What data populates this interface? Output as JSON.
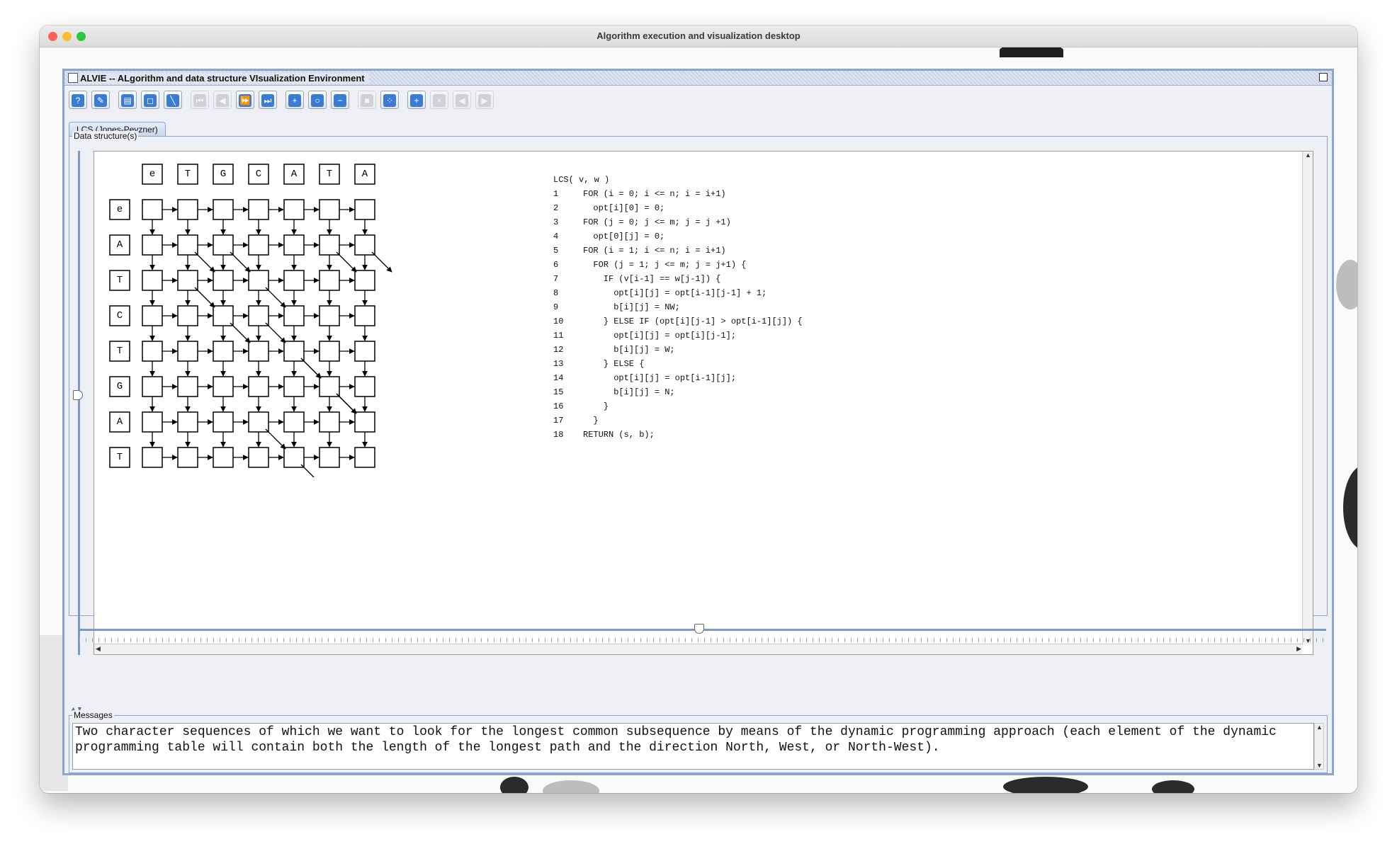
{
  "mac": {
    "title": "Algorithm execution and visualization desktop"
  },
  "alvie": {
    "title": "ALVIE -- ALgorithm and data structure VIsualization Environment",
    "tab_label": "LCS (Jones-Pevzner)",
    "ds_group_label": "Data structure(s)",
    "msg_group_label": "Messages",
    "message": "Two character sequences of which we want to look for the longest common subsequence by means of the dynamic programming approach (each element of the dynamic programming table will contain both the length of the longest path and the direction North, West, or North-West)."
  },
  "toolbar": {
    "buttons": [
      {
        "name": "help-button",
        "glyph": "?",
        "enabled": true
      },
      {
        "name": "settings-button",
        "glyph": "✎",
        "enabled": true
      },
      {
        "name": "open-button",
        "glyph": "▤",
        "enabled": true
      },
      {
        "name": "window-button",
        "glyph": "◻",
        "enabled": true
      },
      {
        "name": "edit-button",
        "glyph": "╲",
        "enabled": true
      },
      {
        "name": "first-step-button",
        "glyph": "⏮",
        "enabled": false
      },
      {
        "name": "back-button",
        "glyph": "◀",
        "enabled": false
      },
      {
        "name": "forward-button",
        "glyph": "⏩",
        "enabled": true
      },
      {
        "name": "last-step-button",
        "glyph": "⏭",
        "enabled": true
      },
      {
        "name": "zoom-in-button",
        "glyph": "+",
        "enabled": true
      },
      {
        "name": "zoom-button",
        "glyph": "○",
        "enabled": true
      },
      {
        "name": "zoom-out-button",
        "glyph": "−",
        "enabled": true
      },
      {
        "name": "lock-button",
        "glyph": "■",
        "enabled": false
      },
      {
        "name": "arrange-button",
        "glyph": "⁘",
        "enabled": true
      },
      {
        "name": "add-button",
        "glyph": "+",
        "enabled": true
      },
      {
        "name": "remove-button",
        "glyph": "×",
        "enabled": false
      },
      {
        "name": "left-button",
        "glyph": "◀",
        "enabled": false
      },
      {
        "name": "right-button",
        "glyph": "▶",
        "enabled": false
      }
    ]
  },
  "lcs": {
    "columns": [
      "e",
      "T",
      "G",
      "C",
      "A",
      "T",
      "A"
    ],
    "rows": [
      "e",
      "A",
      "T",
      "C",
      "T",
      "G",
      "A",
      "T"
    ],
    "diagonals": [
      [
        2,
        3
      ],
      [
        4,
        4
      ],
      [
        5,
        5
      ],
      [
        1,
        1
      ],
      [
        1,
        5
      ],
      [
        1,
        6
      ],
      [
        3,
        3
      ],
      [
        1,
        2
      ],
      [
        4,
        4
      ],
      [
        5,
        5
      ],
      [
        2,
        1
      ],
      [
        3,
        2
      ],
      [
        6,
        3
      ],
      [
        7,
        4
      ]
    ]
  },
  "code": {
    "header": "LCS( v, w )",
    "lines": [
      {
        "n": "1",
        "text": "FOR (i = 0; i <= n; i = i+1)"
      },
      {
        "n": "2",
        "text": "  opt[i][0] = 0;"
      },
      {
        "n": "3",
        "text": "FOR (j = 0; j <= m; j = j +1)"
      },
      {
        "n": "4",
        "text": "  opt[0][j] = 0;"
      },
      {
        "n": "5",
        "text": "FOR (i = 1; i <= n; i = i+1)"
      },
      {
        "n": "6",
        "text": "  FOR (j = 1; j <= m; j = j+1) {"
      },
      {
        "n": "7",
        "text": "    IF (v[i-1] == w[j-1]) {"
      },
      {
        "n": "8",
        "text": "      opt[i][j] = opt[i-1][j-1] + 1;"
      },
      {
        "n": "9",
        "text": "      b[i][j] = NW;"
      },
      {
        "n": "10",
        "text": "    } ELSE IF (opt[i][j-1] > opt[i-1][j]) {"
      },
      {
        "n": "11",
        "text": "      opt[i][j] = opt[i][j-1];"
      },
      {
        "n": "12",
        "text": "      b[i][j] = W;"
      },
      {
        "n": "13",
        "text": "    } ELSE {"
      },
      {
        "n": "14",
        "text": "      opt[i][j] = opt[i-1][j];"
      },
      {
        "n": "15",
        "text": "      b[i][j] = N;"
      },
      {
        "n": "16",
        "text": "    }"
      },
      {
        "n": "17",
        "text": "  }"
      },
      {
        "n": "18",
        "text": "RETURN (s, b);"
      }
    ]
  }
}
